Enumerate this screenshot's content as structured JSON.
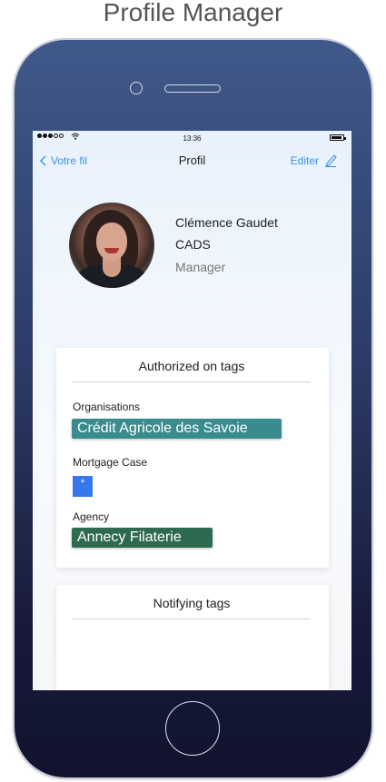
{
  "page": {
    "title": "Profile Manager"
  },
  "status_bar": {
    "time": "13:36"
  },
  "nav": {
    "back_label": "Votre fil",
    "title": "Profil",
    "edit_label": "Editer"
  },
  "profile": {
    "name": "Clémence Gaudet",
    "company": "CADS",
    "role": "Manager"
  },
  "authorized_card": {
    "title": "Authorized on tags",
    "organisations_label": "Organisations",
    "organisations_tag": "Crédit Agricole des Savoie",
    "mortgage_label": "Mortgage Case",
    "mortgage_tag": "*",
    "agency_label": "Agency",
    "agency_tag": "Annecy Filaterie"
  },
  "notifying_card": {
    "title": "Notifying tags"
  },
  "colors": {
    "accent": "#3d8fe6",
    "organisations_tag": "#3a8b8d",
    "mortgage_tag": "#3478ec",
    "agency_tag": "#2e6a50"
  },
  "icons": {
    "back": "chevron-left-icon",
    "edit": "pencil-icon",
    "wifi": "wifi-icon",
    "battery": "battery-icon",
    "signal": "signal-dots-icon"
  }
}
